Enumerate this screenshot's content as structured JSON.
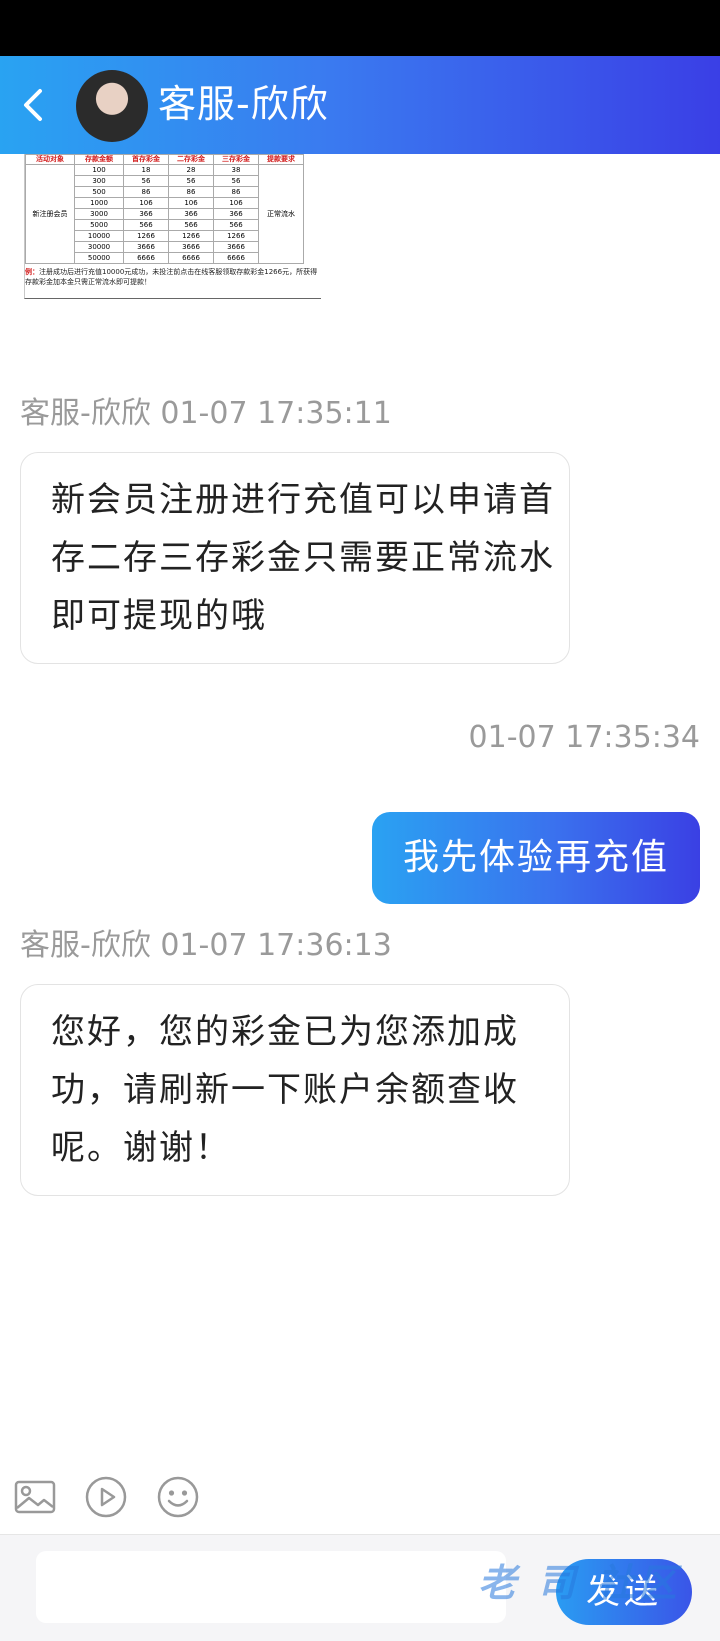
{
  "header": {
    "title": "客服-欣欣"
  },
  "promo": {
    "headers": [
      "活动对象",
      "存款金额",
      "首存彩金",
      "二存彩金",
      "三存彩金",
      "提款要求"
    ],
    "target": "新注册会员",
    "requirement": "正常流水",
    "rows": [
      [
        "100",
        "18",
        "28",
        "38"
      ],
      [
        "300",
        "56",
        "56",
        "56"
      ],
      [
        "500",
        "86",
        "86",
        "86"
      ],
      [
        "1000",
        "106",
        "106",
        "106"
      ],
      [
        "3000",
        "366",
        "366",
        "366"
      ],
      [
        "5000",
        "566",
        "566",
        "566"
      ],
      [
        "10000",
        "1266",
        "1266",
        "1266"
      ],
      [
        "30000",
        "3666",
        "3666",
        "3666"
      ],
      [
        "50000",
        "6666",
        "6666",
        "6666"
      ]
    ],
    "note_prefix": "例：",
    "note": "注册成功后进行充值10000元成功，未投注前点击在线客服领取存款彩金1266元，所获得存款彩金加本金只需正常流水即可提款！"
  },
  "messages": [
    {
      "sender": "客服-欣欣",
      "time": "01-07 17:35:11",
      "text": "新会员注册进行充值可以申请首存二存三存彩金只需要正常流水即可提现的哦"
    },
    {
      "sender": "",
      "time": "01-07 17:35:34",
      "text": "我先体验再充值"
    },
    {
      "sender": "客服-欣欣",
      "time": "01-07 17:36:13",
      "text": "您好，您的彩金已为您添加成功，请刷新一下账户余额查收呢。谢谢！"
    }
  ],
  "input": {
    "value": "",
    "send_label": "发送"
  },
  "watermark": "老 司 社区",
  "colors": {
    "header_start": "#29a3f2",
    "header_end": "#3a3fe6",
    "meta_text": "#9a9a9a"
  }
}
